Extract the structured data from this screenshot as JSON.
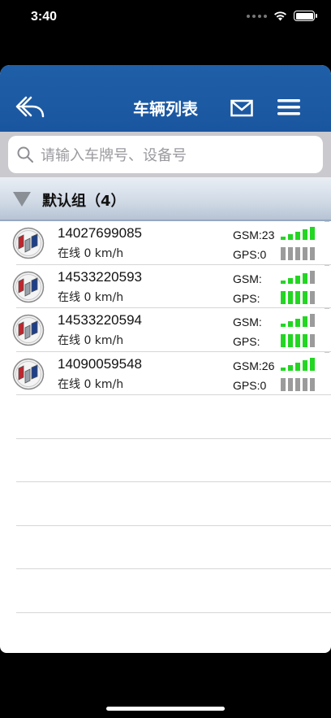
{
  "status_bar": {
    "time": "3:40"
  },
  "nav": {
    "title": "车辆列表",
    "back_icon": "back-arrow-icon",
    "mail_icon": "mail-icon",
    "menu_icon": "hamburger-menu-icon"
  },
  "search": {
    "placeholder": "请输入车牌号、设备号"
  },
  "group": {
    "name": "默认组（4）"
  },
  "vehicles": [
    {
      "plate": "14027699085",
      "status": "在线 0 km/h",
      "gsm": "GSM:23",
      "gps": "GPS:0",
      "gsm_level": 5,
      "gps_level": 0
    },
    {
      "plate": "14533220593",
      "status": "在线 0 km/h",
      "gsm": "GSM:",
      "gps": "GPS:",
      "gsm_level": 4,
      "gps_level": 4
    },
    {
      "plate": "14533220594",
      "status": "在线 0 km/h",
      "gsm": "GSM:",
      "gps": "GPS:",
      "gsm_level": 4,
      "gps_level": 4
    },
    {
      "plate": "14090059548",
      "status": "在线 0 km/h",
      "gsm": "GSM:26",
      "gps": "GPS:0",
      "gsm_level": 5,
      "gps_level": 0
    }
  ],
  "colors": {
    "nav_blue": "#1d5ca6",
    "signal_green": "#22d622",
    "signal_gray": "#9b9b9b"
  }
}
